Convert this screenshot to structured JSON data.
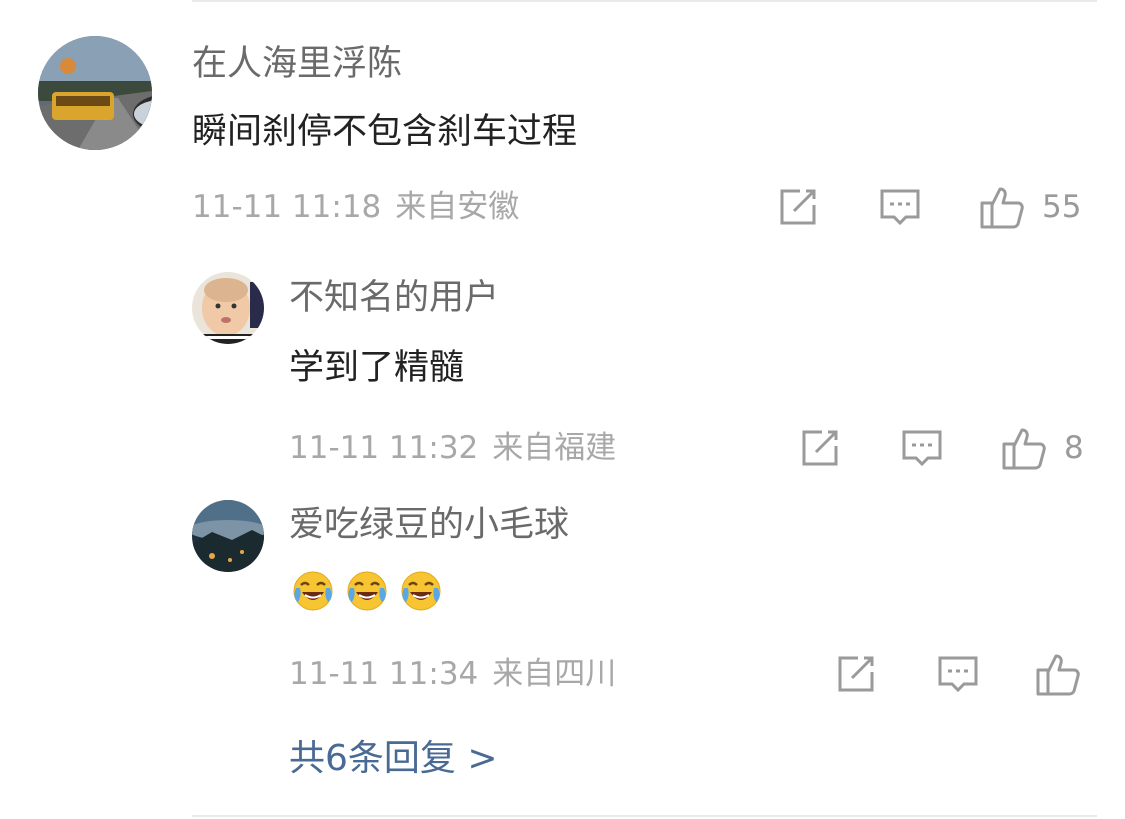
{
  "comment": {
    "username": "在人海里浮陈",
    "text": "瞬间刹停不包含刹车过程",
    "time": "11-11 11:18",
    "source": "来自安徽",
    "likes": "55",
    "icons": [
      "edit-icon",
      "comment-icon",
      "thumbs-up-icon"
    ]
  },
  "replies": [
    {
      "username": "不知名的用户",
      "text": "学到了精髓",
      "time": "11-11 11:32",
      "source": "来自福建",
      "likes": "8"
    },
    {
      "username": "爱吃绿豆的小毛球",
      "emoji": [
        "laugh-cry-emoji",
        "laugh-cry-emoji",
        "laugh-cry-emoji"
      ],
      "time": "11-11 11:34",
      "source": "来自四川",
      "likes": ""
    }
  ],
  "more_replies_label": "共6条回复 >",
  "colors": {
    "meta_gray": "#a8a8a8",
    "link_blue": "#4a6a96",
    "icon_gray": "#9a9a9a"
  }
}
